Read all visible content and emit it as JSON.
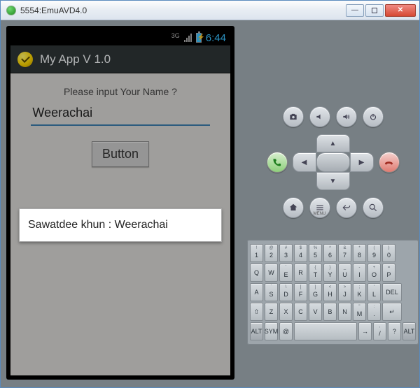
{
  "window": {
    "title": "5554:EmuAVD4.0"
  },
  "statusbar": {
    "network": "3G",
    "time": "6:44"
  },
  "actionbar": {
    "title": "My App V 1.0"
  },
  "app": {
    "prompt": "Please input Your Name ?",
    "name_value": "Weerachai",
    "button_label": "Button"
  },
  "toast": {
    "message": "Sawatdee khun : Weerachai"
  },
  "controls": {
    "row1": [
      "camera",
      "vol-down",
      "vol-up",
      "power"
    ],
    "row3": [
      "home",
      "menu",
      "back",
      "search"
    ],
    "menu_label": "MENU"
  },
  "keyboard": {
    "rows": [
      [
        {
          "m": "1",
          "s": "!"
        },
        {
          "m": "2",
          "s": "@"
        },
        {
          "m": "3",
          "s": "#"
        },
        {
          "m": "4",
          "s": "$"
        },
        {
          "m": "5",
          "s": "%"
        },
        {
          "m": "6",
          "s": "^"
        },
        {
          "m": "7",
          "s": "&"
        },
        {
          "m": "8",
          "s": "*"
        },
        {
          "m": "9",
          "s": "("
        },
        {
          "m": "0",
          "s": ")"
        }
      ],
      [
        {
          "m": "Q"
        },
        {
          "m": "W"
        },
        {
          "m": "E",
          "s": "´"
        },
        {
          "m": "R"
        },
        {
          "m": "T",
          "s": "{"
        },
        {
          "m": "Y",
          "s": "}"
        },
        {
          "m": "U",
          "s": "_"
        },
        {
          "m": "I",
          "s": "-"
        },
        {
          "m": "O",
          "s": "+"
        },
        {
          "m": "P",
          "s": "="
        }
      ],
      [
        {
          "m": "A"
        },
        {
          "m": "S",
          "s": "`"
        },
        {
          "m": "D",
          "s": "\\"
        },
        {
          "m": "F",
          "s": "["
        },
        {
          "m": "G",
          "s": "]"
        },
        {
          "m": "H",
          "s": "<"
        },
        {
          "m": "J",
          "s": ">"
        },
        {
          "m": "K",
          "s": ";"
        },
        {
          "m": "L",
          "s": "'"
        },
        {
          "m": "DEL",
          "s": "",
          "cls": "w15"
        }
      ],
      [
        {
          "m": "⇧",
          "cls": "single"
        },
        {
          "m": "Z"
        },
        {
          "m": "X"
        },
        {
          "m": "C"
        },
        {
          "m": "V"
        },
        {
          "m": "B"
        },
        {
          "m": "N"
        },
        {
          "m": "M",
          "s": "\""
        },
        {
          "m": ".",
          "s": ":"
        },
        {
          "m": "↵",
          "cls": "w15 single"
        }
      ],
      [
        {
          "m": "ALT",
          "cls": "alt single"
        },
        {
          "m": "SYM",
          "cls": "single",
          "s": ""
        },
        {
          "m": "@",
          "cls": "single"
        },
        {
          "m": " ",
          "cls": "space single"
        },
        {
          "m": "→",
          "cls": "single",
          "s": ""
        },
        {
          "m": "/",
          "s": ","
        },
        {
          "m": "?",
          "s": ""
        },
        {
          "m": "ALT",
          "cls": "alt single"
        }
      ]
    ]
  }
}
